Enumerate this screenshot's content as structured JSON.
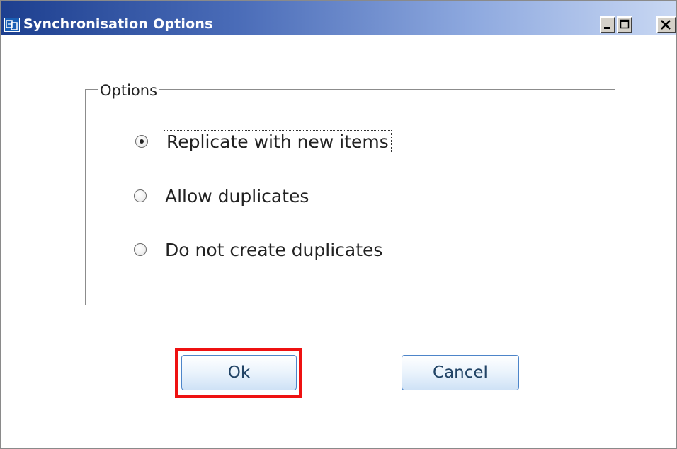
{
  "window": {
    "title": "Synchronisation Options",
    "app_icon": "application-icon",
    "controls": [
      {
        "name": "minimize-button",
        "icon": "minimize-icon"
      },
      {
        "name": "maximize-button",
        "icon": "maximize-icon"
      },
      {
        "name": "close-button",
        "icon": "close-icon"
      }
    ]
  },
  "options_group": {
    "legend": "Options",
    "selected_index": 0,
    "radios": [
      {
        "label": "Replicate with new items",
        "checked": true,
        "focused": true
      },
      {
        "label": "Allow duplicates",
        "checked": false,
        "focused": false
      },
      {
        "label": "Do not create duplicates",
        "checked": false,
        "focused": false
      }
    ]
  },
  "buttons": {
    "ok_label": "Ok",
    "cancel_label": "Cancel"
  },
  "colors": {
    "title_gradient_start": "#1d3f8f",
    "title_gradient_end": "#c9d8f3",
    "button_border": "#4d85c9",
    "highlight": "#ee1111"
  }
}
